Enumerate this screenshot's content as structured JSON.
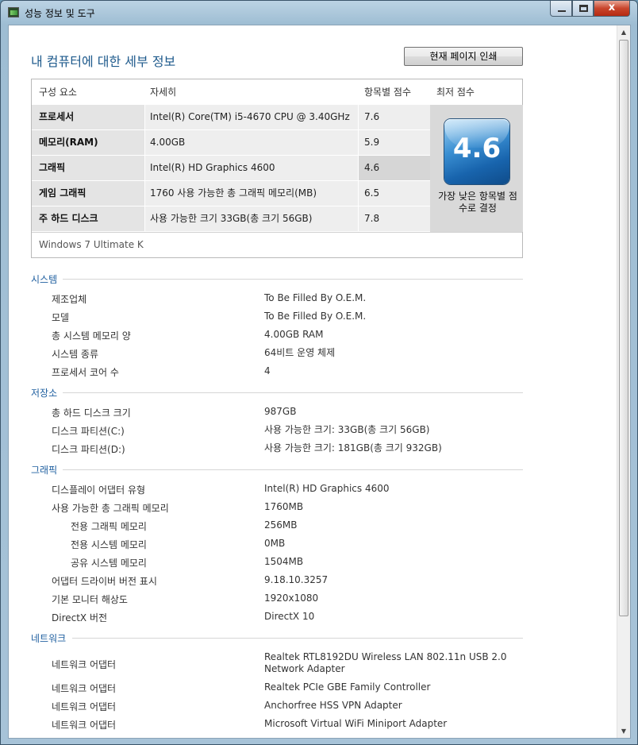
{
  "window": {
    "title": "성능 정보 및 도구",
    "close_glyph": "x"
  },
  "heading": "내 컴퓨터에 대한 세부 정보",
  "print_button": "현재 페이지 인쇄",
  "score_table": {
    "headers": [
      "구성 요소",
      "자세히",
      "항목별 점수",
      "최저 점수"
    ],
    "rows": [
      {
        "component": "프로세서",
        "detail": "Intel(R) Core(TM) i5-4670 CPU @ 3.40GHz",
        "score": "7.6"
      },
      {
        "component": "메모리(RAM)",
        "detail": "4.00GB",
        "score": "5.9"
      },
      {
        "component": "그래픽",
        "detail": "Intel(R) HD Graphics 4600",
        "score": "4.6"
      },
      {
        "component": "게임 그래픽",
        "detail": "1760 사용 가능한 총 그래픽 메모리(MB)",
        "score": "6.5"
      },
      {
        "component": "주 하드 디스크",
        "detail": "사용 가능한 크기 33GB(총 크기 56GB)",
        "score": "7.8"
      }
    ],
    "base_score": "4.6",
    "base_caption": "가장 낮은 항목별 점수로 결정",
    "os": "Windows 7 Ultimate K"
  },
  "sections": {
    "system": {
      "title": "시스템",
      "items": [
        {
          "label": "제조업체",
          "value": "To Be Filled By O.E.M."
        },
        {
          "label": "모델",
          "value": "To Be Filled By O.E.M."
        },
        {
          "label": "총 시스템 메모리 양",
          "value": "4.00GB RAM"
        },
        {
          "label": "시스템 종류",
          "value": "64비트 운영 체제"
        },
        {
          "label": "프로세서 코어 수",
          "value": "4"
        }
      ]
    },
    "storage": {
      "title": "저장소",
      "items": [
        {
          "label": "총 하드 디스크 크기",
          "value": "987GB"
        },
        {
          "label": "디스크 파티션(C:)",
          "value": "사용 가능한 크기: 33GB(총 크기 56GB)"
        },
        {
          "label": "디스크 파티션(D:)",
          "value": "사용 가능한 크기: 181GB(총 크기 932GB)"
        }
      ]
    },
    "graphics": {
      "title": "그래픽",
      "items": [
        {
          "label": "디스플레이 어댑터 유형",
          "value": "Intel(R) HD Graphics 4600"
        },
        {
          "label": "사용 가능한 총 그래픽 메모리",
          "value": "1760MB"
        },
        {
          "label": "전용 그래픽 메모리",
          "value": "256MB"
        },
        {
          "label": "전용 시스템 메모리",
          "value": "0MB"
        },
        {
          "label": "공유 시스템 메모리",
          "value": "1504MB"
        },
        {
          "label": "어댑터 드라이버 버전 표시",
          "value": "9.18.10.3257"
        },
        {
          "label": "기본 모니터 해상도",
          "value": "1920x1080"
        },
        {
          "label": "DirectX 버전",
          "value": "DirectX 10"
        }
      ]
    },
    "network": {
      "title": "네트워크",
      "items": [
        {
          "label": "네트워크 어댑터",
          "value_line1": "Realtek RTL8192DU Wireless LAN 802.11n USB 2.0",
          "value_line2": "Network Adapter"
        },
        {
          "label": "네트워크 어댑터",
          "value": "Realtek PCIe GBE Family Controller"
        },
        {
          "label": "네트워크 어댑터",
          "value": "Anchorfree HSS VPN Adapter"
        },
        {
          "label": "네트워크 어댑터",
          "value": "Microsoft Virtual WiFi Miniport Adapter"
        }
      ]
    }
  }
}
